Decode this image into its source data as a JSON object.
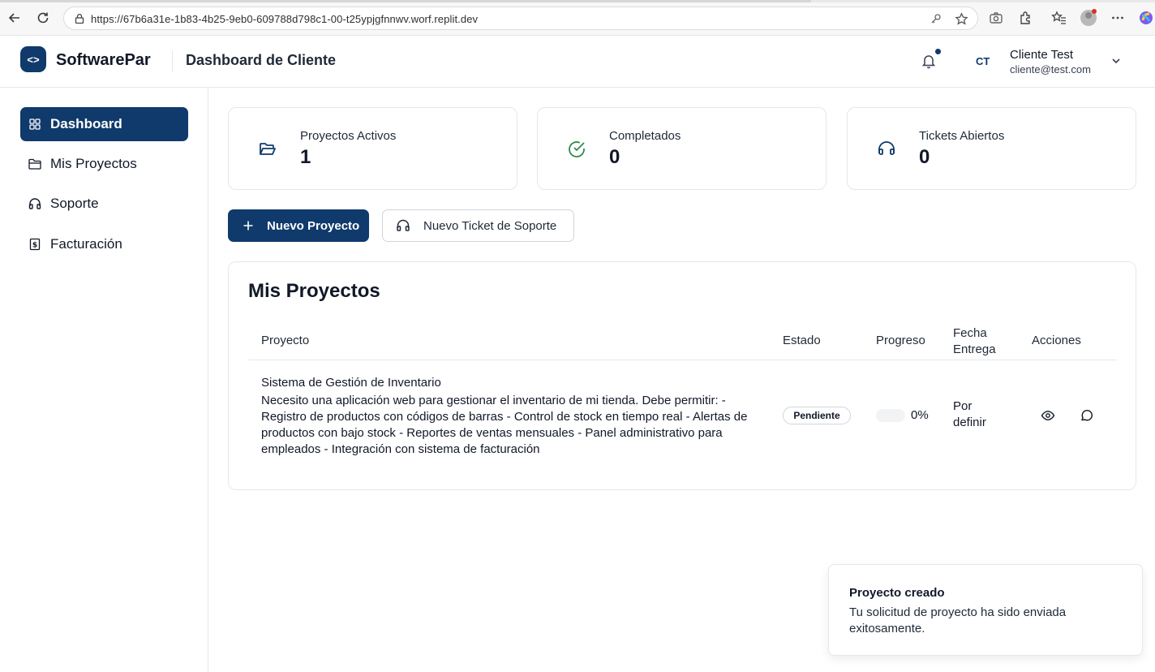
{
  "browser": {
    "url": "https://67b6a31e-1b83-4b25-9eb0-609788d798c1-00-t25ypjgfnnwv.worf.replit.dev"
  },
  "header": {
    "brand": "SoftwarePar",
    "logo_glyph": "<>",
    "title": "Dashboard de Cliente",
    "user_initials": "CT",
    "user_name": "Cliente Test",
    "user_email": "cliente@test.com"
  },
  "sidebar": {
    "items": [
      {
        "label": "Dashboard",
        "icon": "grid-icon",
        "active": true
      },
      {
        "label": "Mis Proyectos",
        "icon": "folder-icon",
        "active": false
      },
      {
        "label": "Soporte",
        "icon": "headphones-icon",
        "active": false
      },
      {
        "label": "Facturación",
        "icon": "receipt-icon",
        "active": false
      }
    ]
  },
  "stats": [
    {
      "label": "Proyectos Activos",
      "value": "1",
      "icon": "folder-open-icon",
      "color": "#0f3a6b"
    },
    {
      "label": "Completados",
      "value": "0",
      "icon": "check-circle-icon",
      "color": "#2f8a4c"
    },
    {
      "label": "Tickets Abiertos",
      "value": "0",
      "icon": "headphones-icon",
      "color": "#0f3a6b"
    }
  ],
  "actions": {
    "new_project": "Nuevo Proyecto",
    "new_ticket": "Nuevo Ticket de Soporte"
  },
  "projects": {
    "title": "Mis Proyectos",
    "columns": [
      "Proyecto",
      "Estado",
      "Progreso",
      "Fecha\nEntrega",
      "Acciones"
    ],
    "rows": [
      {
        "name": "Sistema de Gestión de Inventario",
        "description": "Necesito una aplicación web para gestionar el inventario de mi tienda. Debe permitir: - Registro de productos con códigos de barras - Control de stock en tiempo real - Alertas de productos con bajo stock - Reportes de ventas mensuales - Panel administrativo para empleados - Integración con sistema de facturación",
        "status": "Pendiente",
        "progress": 0,
        "progress_label": "0%",
        "due": "Por definir",
        "actions": [
          "eye-icon",
          "message-icon"
        ]
      }
    ]
  },
  "toast": {
    "title": "Proyecto creado",
    "message": "Tu solicitud de proyecto ha sido enviada exitosamente."
  },
  "colors": {
    "primary": "#0f3a6b",
    "success": "#2f8a4c",
    "border": "#e5e7eb"
  }
}
